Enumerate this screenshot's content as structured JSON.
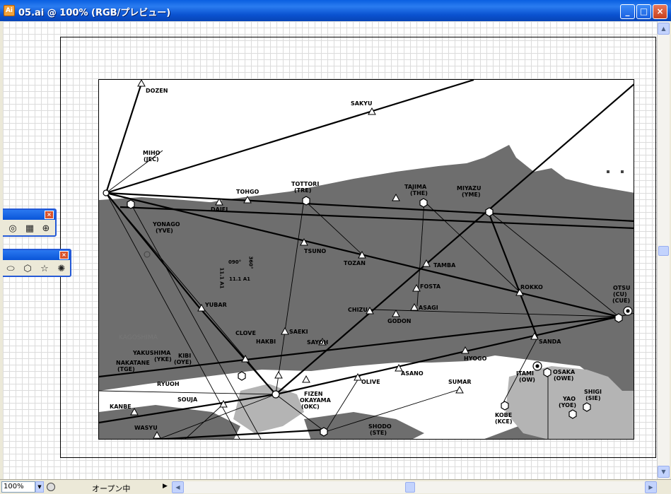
{
  "window": {
    "title": "05.ai @ 100% (RGB/プレビュー)",
    "app_icon": "Ai",
    "minimize_icon": "_",
    "maximize_icon": "□",
    "close_icon": "×"
  },
  "status": {
    "zoom": "100%",
    "zoom_arrow": "▼",
    "text": "オープン中",
    "arrow": "▶"
  },
  "scroll": {
    "up": "▲",
    "down": "▼",
    "left": "◀",
    "right": "▶"
  },
  "palettes": {
    "p1_close": "×",
    "p1_tools": [
      "spiral-tool",
      "rectangular-grid-tool",
      "polar-grid-tool"
    ],
    "p1_glyphs": [
      "◎",
      "▦",
      "⊕"
    ],
    "p2_close": "×",
    "p2_tools": [
      "ellipse-tool",
      "polygon-tool",
      "star-tool",
      "flare-tool"
    ],
    "p2_glyphs": [
      "⬭",
      "⬡",
      "☆",
      "✺"
    ]
  },
  "map_labels": {
    "dozen": "DOZEN",
    "sakyu": "SAKYU",
    "miho": "MIHO",
    "jec": "(JEC)",
    "tottori": "TOTTORI",
    "tre": "(TRE)",
    "tohgo": "TOHGO",
    "daiei": "DAIEI",
    "tajima": "TAJIMA",
    "the": "(THE)",
    "miyazu": "MIYAZU",
    "yme": "(YME)",
    "yonago": "YONAGO",
    "yve": "(YVE)",
    "tsuno": "TSUNO",
    "tozan": "TOZAN",
    "tamba": "TAMBA",
    "fosta": "FOSTA",
    "asagi": "ASAGI",
    "rokko": "ROKKO",
    "otsu": "OTSU",
    "cu": "(CU)",
    "cue": "(CUE)",
    "yubar": "YUBAR",
    "chizu": "CHIZU",
    "godon": "GODON",
    "kagoshima": "KAGOSHIMA",
    "clove": "CLOVE",
    "saeki": "SAEKI",
    "hakbi": "HAKBI",
    "sayoh": "SAYOH",
    "hyogo": "HYOGO",
    "sanda": "SANDA",
    "yakushima": "YAKUSHIMA",
    "yke": "(YKE)",
    "kibi": "KIBI",
    "oye": "(OYE)",
    "nakatane": "NAKATANE",
    "tge": "(TGE)",
    "itami": "ITAMI",
    "ow": "(OW)",
    "osaka": "OSAKA",
    "owe": "(OWE)",
    "asano": "ASANO",
    "ryuoh": "RYUOH",
    "olive": "OLIVE",
    "fizen": "FIZEN",
    "okayama": "OKAYAMA",
    "okc": "(OKC)",
    "sumar": "SUMAR",
    "shigi": "SHIGI",
    "sie": "(SIE)",
    "yao": "YAO",
    "yoe": "(YOE)",
    "souja": "SOUJA",
    "kanbe": "KANBE",
    "kobe": "KOBE",
    "kce": "(KCE)",
    "wasyu": "WASYU",
    "shodo": "SHODO",
    "ste": "(STE)",
    "deg090": "090°",
    "deg360": "360°",
    "a1_left": "11.1 A1",
    "a1_right": "11.1 A1"
  },
  "colors": {
    "land": "#6e6e6e",
    "sea": "#ffffff",
    "light_land": "#b4b4b4",
    "route": "#000000"
  }
}
